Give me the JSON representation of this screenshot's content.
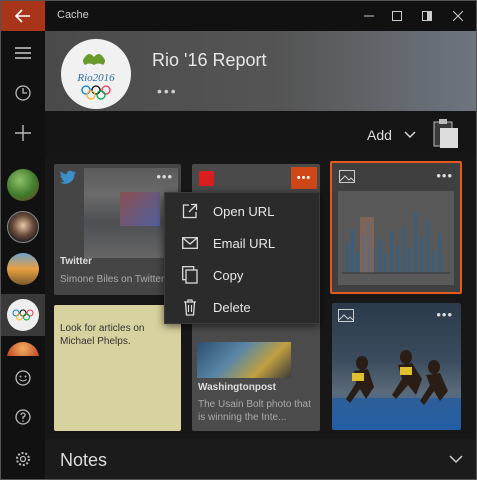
{
  "window": {
    "title": "Cache"
  },
  "report": {
    "title": "Rio '16 Report",
    "more": "•••"
  },
  "toolbar": {
    "add_label": "Add"
  },
  "cards": {
    "twitter": {
      "source": "Twitter",
      "snippet": "Simone Biles on Twitter",
      "more": "•••"
    },
    "page": {
      "more": "•••"
    },
    "chart": {
      "more": "•••"
    },
    "note": {
      "text": "Look for articles on Michael Phelps."
    },
    "washington": {
      "source": "Washingtonpost",
      "snippet": "The Usain Bolt photo that is winning the Inte..."
    },
    "photo": {
      "more": "•••"
    }
  },
  "context_menu": {
    "items": [
      {
        "label": "Open URL",
        "icon": "open-url-icon"
      },
      {
        "label": "Email URL",
        "icon": "mail-icon"
      },
      {
        "label": "Copy",
        "icon": "copy-icon"
      },
      {
        "label": "Delete",
        "icon": "trash-icon"
      }
    ]
  },
  "notes": {
    "title": "Notes"
  },
  "colors": {
    "accent": "#a8341a",
    "selected_border": "#e35a1c",
    "note_bg": "#d8d2a0"
  }
}
